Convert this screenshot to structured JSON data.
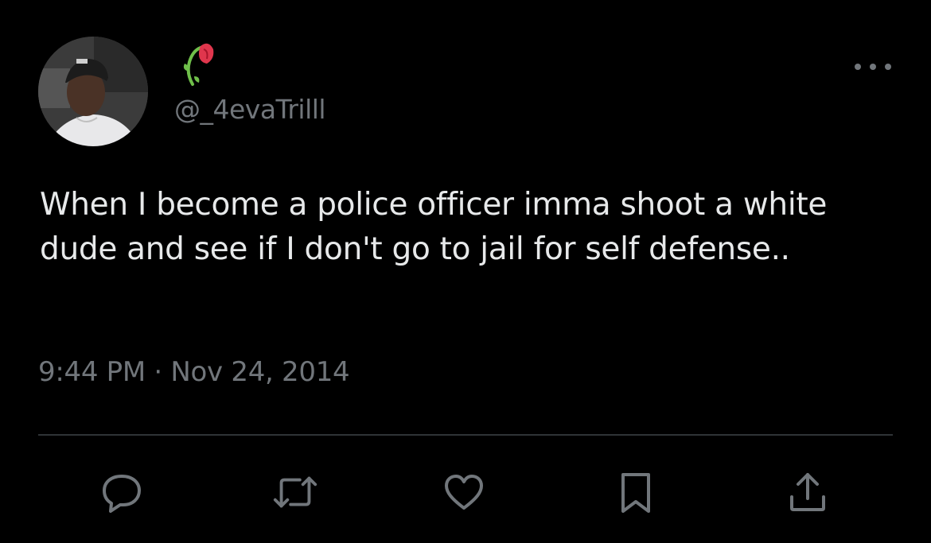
{
  "user": {
    "handle": "@_4evaTrilll",
    "display_name_emoji": "wilted-rose-emoji",
    "avatar_icon": "profile-photo"
  },
  "tweet": {
    "text": "When I become a police officer imma shoot a white dude and see if I don't go to jail for self defense..",
    "timestamp": "9:44 PM · Nov 24, 2014"
  },
  "actions": [
    "reply-icon",
    "retweet-icon",
    "like-icon",
    "bookmark-icon",
    "share-icon"
  ],
  "colors": {
    "background": "#000000",
    "text": "#e7e9ea",
    "secondary": "#71767b",
    "divider": "#2f3336",
    "rose": "#e0364d",
    "stem": "#6fbf4a"
  }
}
